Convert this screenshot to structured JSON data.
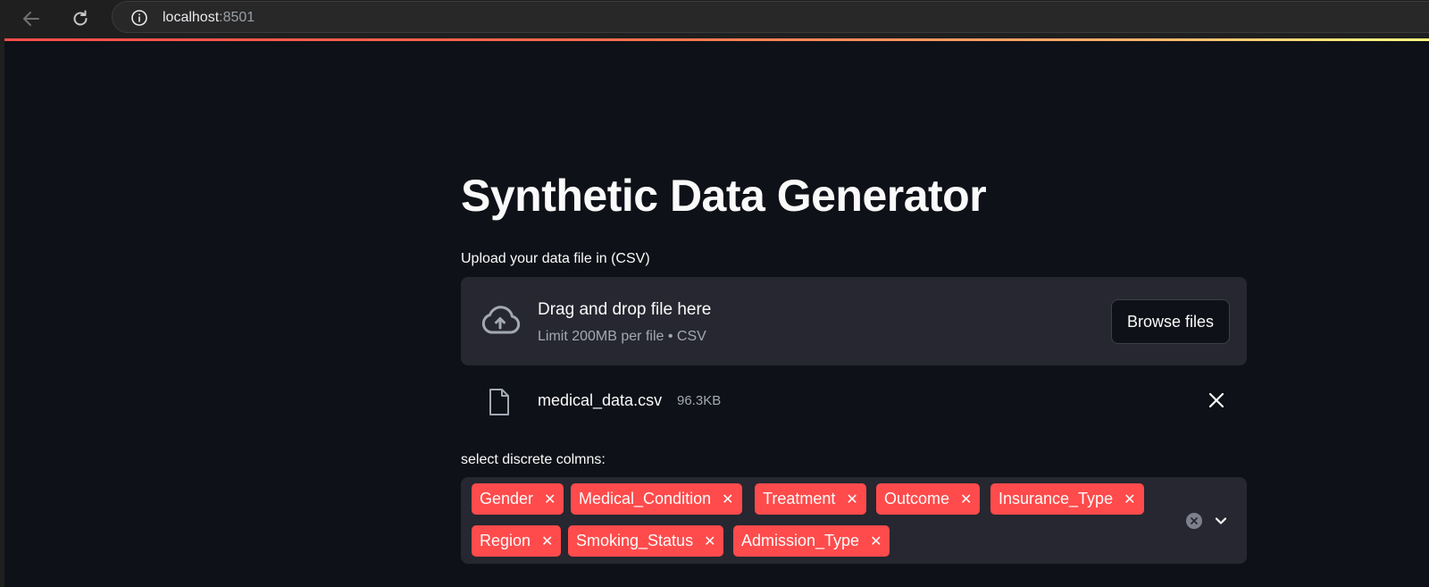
{
  "browser": {
    "url_host": "localhost",
    "url_port": ":8501"
  },
  "colors": {
    "accent": "#ff4b4b",
    "background": "#0e1117",
    "widget_bg": "#262730"
  },
  "page": {
    "title": "Synthetic Data Generator"
  },
  "uploader": {
    "label": "Upload your data file in (CSV)",
    "dropzone_title": "Drag and drop file here",
    "dropzone_subtitle": "Limit 200MB per file • CSV",
    "browse_label": "Browse files",
    "icon": "cloud-upload-icon",
    "file": {
      "name": "medical_data.csv",
      "size": "96.3KB",
      "icon": "file-icon"
    }
  },
  "discrete": {
    "label": "select discrete colmns:",
    "tags": [
      "Gender",
      "Medical_Condition",
      "Treatment",
      "Outcome",
      "Insurance_Type",
      "Region",
      "Smoking_Status",
      "Admission_Type"
    ],
    "remove_glyph": "✕"
  }
}
